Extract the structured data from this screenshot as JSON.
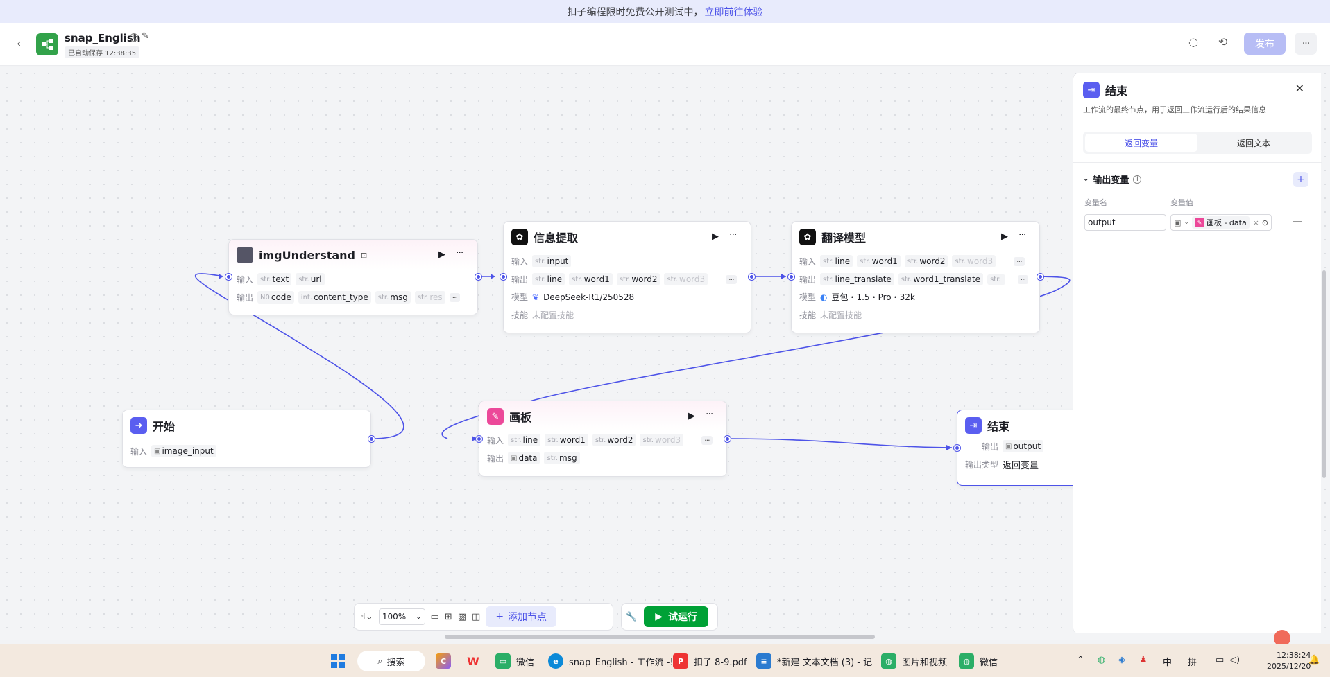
{
  "banner": {
    "text": "扣子编程限时免费公开测试中，",
    "link": "立即前往体验"
  },
  "header": {
    "title": "snap_English",
    "saved": "已自动保存 12:38:35",
    "publish": "发布"
  },
  "nodes": {
    "img": {
      "title": "imgUnderstand",
      "in_label": "输入",
      "in": [
        [
          "str.",
          "text"
        ],
        [
          "str.",
          "url"
        ]
      ],
      "out_label": "输出",
      "out": [
        [
          "N0",
          "code"
        ],
        [
          "int.",
          "content_type"
        ],
        [
          "str.",
          "msg"
        ],
        [
          "str.",
          "res"
        ]
      ]
    },
    "info": {
      "title": "信息提取",
      "in_label": "输入",
      "in": [
        [
          "str.",
          "input"
        ]
      ],
      "out_label": "输出",
      "out": [
        [
          "str.",
          "line"
        ],
        [
          "str.",
          "word1"
        ],
        [
          "str.",
          "word2"
        ],
        [
          "str.",
          "word3"
        ]
      ],
      "model_label": "模型",
      "model": "DeepSeek-R1/250528",
      "skill_label": "技能",
      "skill": "未配置技能"
    },
    "trans": {
      "title": "翻译模型",
      "in_label": "输入",
      "in": [
        [
          "str.",
          "line"
        ],
        [
          "str.",
          "word1"
        ],
        [
          "str.",
          "word2"
        ],
        [
          "str.",
          "word3"
        ]
      ],
      "out_label": "输出",
      "out": [
        [
          "str.",
          "line_translate"
        ],
        [
          "str.",
          "word1_translate"
        ],
        [
          "str.",
          ""
        ]
      ],
      "model_label": "模型",
      "model": "豆包・1.5・Pro・32k",
      "skill_label": "技能",
      "skill": "未配置技能"
    },
    "start": {
      "title": "开始",
      "in_label": "输入",
      "in": "image_input"
    },
    "board": {
      "title": "画板",
      "in_label": "输入",
      "in": [
        [
          "str.",
          "line"
        ],
        [
          "str.",
          "word1"
        ],
        [
          "str.",
          "word2"
        ],
        [
          "str.",
          "word3"
        ]
      ],
      "out_label": "输出",
      "out": [
        "data",
        "msg"
      ]
    },
    "end": {
      "title": "结束",
      "out_label": "输出",
      "out": "output",
      "type_label": "输出类型",
      "type": "返回变量"
    }
  },
  "panel": {
    "title": "结束",
    "desc": "工作流的最终节点，用于返回工作流运行后的结果信息",
    "tabs": [
      "返回变量",
      "返回文本"
    ],
    "section": "输出变量",
    "col_name": "变量名",
    "col_value": "变量值",
    "var_name": "output",
    "var_ref": "画板 - data"
  },
  "toolbar": {
    "zoom": "100%",
    "add_node": "添加节点",
    "trial_run": "试运行"
  },
  "taskbar": {
    "search": "搜索",
    "apps": [
      "微信",
      "snap_English - 工作流 -!",
      "扣子 8-9.pdf",
      "*新建 文本文档 (3) - 记",
      "图片和视频",
      "微信"
    ],
    "ime1": "中",
    "ime2": "拼",
    "time": "12:38:24",
    "date": "2025/12/20"
  }
}
